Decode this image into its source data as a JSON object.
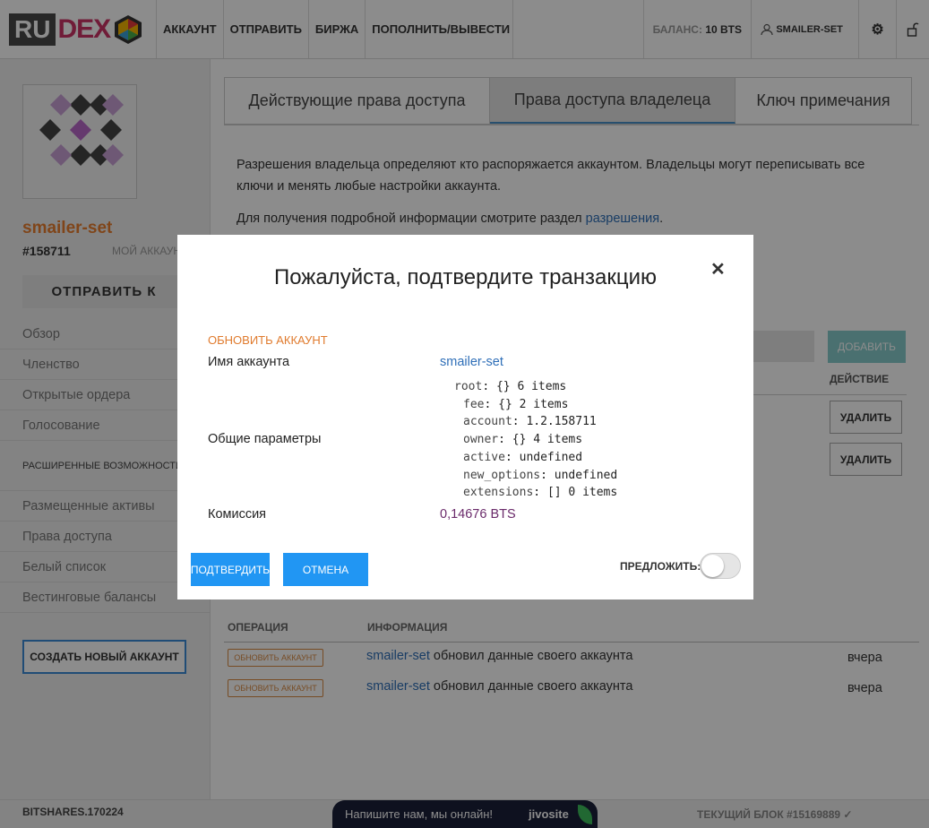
{
  "header": {
    "logo_ru": "RU",
    "logo_dex": "DEX",
    "nav": [
      "АККАУНТ",
      "ОТПРАВИТЬ",
      "БИРЖА",
      "ПОПОЛНИТЬ/ВЫВЕСТИ"
    ],
    "balance_label": "БАЛАНС:",
    "balance_value": "10 BTS",
    "user": "SMAILER-SET"
  },
  "sidebar": {
    "account_name": "smailer-set",
    "account_id": "#158711",
    "my_account": "МОЙ АККАУНТ",
    "send_button": "ОТПРАВИТЬ К",
    "menu": [
      "Обзор",
      "Членство",
      "Открытые ордера",
      "Голосование"
    ],
    "advanced": "РАСШИРЕННЫЕ ВОЗМОЖНОСТИ ▼",
    "menu2": [
      "Размещенные активы",
      "Права доступа",
      "Белый список",
      "Вестинговые балансы"
    ],
    "create_account": "СОЗДАТЬ НОВЫЙ АККАУНТ"
  },
  "main": {
    "tabs": [
      "Действующие права доступа",
      "Права доступа владелеца",
      "Ключ примечания"
    ],
    "description": "Разрешения владельца определяют кто распоряжается аккаунтом. Владельцы могут переписывать все ключи и менять любые настройки аккаунта.",
    "more_info": "Для получения подробной информации смотрите раздел",
    "more_info_link": "разрешения",
    "more_info_end": ".",
    "add_button": "ДОБАВИТЬ",
    "action_header": "ДЕЙСТВИЕ",
    "delete_label": "УДАЛИТЬ",
    "history_col_op": "ОПЕРАЦИЯ",
    "history_col_info": "ИНФОРМАЦИЯ",
    "history": [
      {
        "badge": "ОБНОВИТЬ АККАУНТ",
        "account": "smailer-set",
        "text": " обновил данные своего аккаунта",
        "time": "вчера"
      },
      {
        "badge": "ОБНОВИТЬ АККАУНТ",
        "account": "smailer-set",
        "text": " обновил данные своего аккаунта",
        "time": "вчера"
      }
    ]
  },
  "footer": {
    "version": "BITSHARES.170224",
    "current_block": "ТЕКУЩИЙ БЛОК #15169889",
    "chat_text": "Напишите нам, мы онлайн!",
    "chat_brand": "jivosite"
  },
  "modal": {
    "title": "Пожалуйста, подтвердите транзакцию",
    "operation": "ОБНОВИТЬ АККАУНТ",
    "account_label": "Имя аккаунта",
    "account_value": "smailer-set",
    "params_label": "Общие параметры",
    "json": [
      {
        "key": "root",
        "value": "{} 6 items"
      },
      {
        "key": "fee",
        "value": "{} 2 items"
      },
      {
        "key": "account",
        "value": "1.2.158711"
      },
      {
        "key": "owner",
        "value": "{} 4 items"
      },
      {
        "key": "active",
        "value": "undefined"
      },
      {
        "key": "new_options",
        "value": "undefined"
      },
      {
        "key": "extensions",
        "value": "[] 0 items"
      }
    ],
    "fee_label": "Комиссия",
    "fee_value": "0,14676 BTS",
    "confirm": "ПОДТВЕРДИТЬ",
    "cancel": "ОТМЕНА",
    "propose": "ПРЕДЛОЖИТЬ:"
  }
}
